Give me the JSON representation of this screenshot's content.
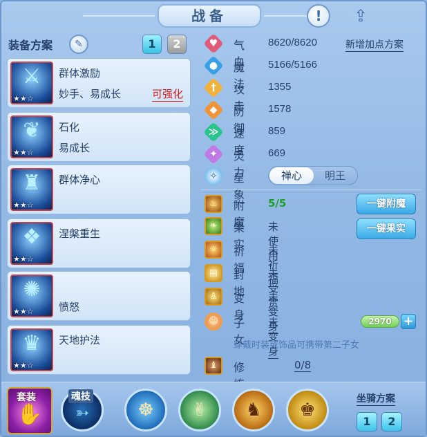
{
  "window": {
    "title": "战备"
  },
  "header": {
    "info_icon": "!",
    "share_icon": "share-icon"
  },
  "equip_plan": {
    "label": "装备方案",
    "plans": [
      "1",
      "2"
    ],
    "active_plan": "1"
  },
  "skills": [
    {
      "name": "群体激励",
      "sub": "妙手、易成长",
      "enhance": "可强化",
      "stars": "★★☆",
      "icon": "sword-icon"
    },
    {
      "name": "石化",
      "sub": "易成长",
      "enhance": "",
      "stars": "★★☆",
      "icon": "bird-icon"
    },
    {
      "name": "群体净心",
      "sub": "",
      "enhance": "",
      "stars": "★★☆",
      "icon": "warrior-icon"
    },
    {
      "name": "涅槃重生",
      "sub": "",
      "enhance": "",
      "stars": "★★☆",
      "icon": "phoenix-icon"
    },
    {
      "name": "",
      "sub": "愤怒",
      "enhance": "",
      "stars": "★★☆",
      "icon": "mask-icon"
    },
    {
      "name": "天地护法",
      "sub": "",
      "enhance": "",
      "stars": "★★☆",
      "icon": "guardian-icon"
    }
  ],
  "stats": [
    {
      "label": "气血",
      "value": "8620/8620",
      "color": "#e05a7a",
      "glyph": "♥"
    },
    {
      "label": "魔法",
      "value": "5166/5166",
      "color": "#3aa0e6",
      "glyph": "●"
    },
    {
      "label": "攻击",
      "value": "1355",
      "color": "#f0b23a",
      "glyph": "†"
    },
    {
      "label": "防御",
      "value": "1578",
      "color": "#f0943a",
      "glyph": "◆"
    },
    {
      "label": "速度",
      "value": "859",
      "color": "#28c48a",
      "glyph": "≫"
    },
    {
      "label": "灵力",
      "value": "669",
      "color": "#c07ae6",
      "glyph": "✦"
    }
  ],
  "add_points_plan": "新增加点方案",
  "star_sign": {
    "label": "星象",
    "options": [
      "禅心",
      "明王"
    ],
    "selected": "禅心"
  },
  "buffs": [
    {
      "label": "附魔",
      "value": "5/5",
      "highlight": true
    },
    {
      "label": "果实",
      "value": "未使用",
      "highlight": false
    },
    {
      "label": "祈福",
      "value": "未祈福",
      "highlight": false
    },
    {
      "label": "封地",
      "value": "未受赏",
      "highlight": false
    },
    {
      "label": "变身",
      "value": "未变身",
      "highlight": false
    },
    {
      "label": "子女",
      "value": "未变身",
      "highlight": false
    }
  ],
  "buttons": {
    "one_click_enchant": "一键附魔",
    "one_click_fruit": "一键果实"
  },
  "child_exp": "2970",
  "hint": "穿戴时装或饰品可携带第二子女",
  "cultivate": {
    "label": "修炼觉醒",
    "value": "0/8"
  },
  "bottom": {
    "suit_label": "套装",
    "soul_skill_label": "魂技",
    "mount_plan_label": "坐骑方案",
    "mount_plans": [
      "1",
      "2"
    ]
  },
  "colors": {
    "enhance": "#d81b1b",
    "enchant_value": "#1f9e2c",
    "active_plan": "#35c2e6"
  }
}
